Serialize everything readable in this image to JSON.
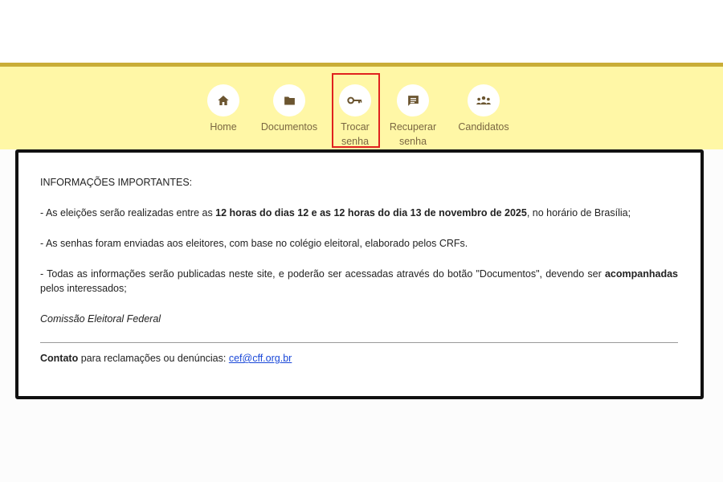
{
  "nav": {
    "items": [
      {
        "label": "Home",
        "icon": "home-icon"
      },
      {
        "label": "Documentos",
        "icon": "folder-icon"
      },
      {
        "label_line1": "Trocar",
        "label_line2": "senha",
        "icon": "key-icon"
      },
      {
        "label_line1": "Recuperar",
        "label_line2": "senha",
        "icon": "message-icon"
      },
      {
        "label": "Candidatos",
        "icon": "people-icon"
      }
    ]
  },
  "colors": {
    "nav_background": "#fff7a6",
    "nav_border": "#c9ad38",
    "icon_color": "#6b5530",
    "highlight": "#e0221f",
    "link": "#1a48d8"
  },
  "content": {
    "heading": "INFORMAÇÕES IMPORTANTES:",
    "p1_prefix": "- As eleições serão realizadas entre as ",
    "p1_bold": "12 horas do dias 12 e as 12 horas do dia 13 de novembro de 2025",
    "p1_suffix": ", no horário de Brasília;",
    "p2": "- As senhas foram enviadas aos eleitores, com base no colégio eleitoral, elaborado pelos CRFs.",
    "p3_prefix": "- Todas as informações serão publicadas neste site, e poderão ser acessadas através do botão \"Documentos\", devendo ser ",
    "p3_bold": "acompanhadas",
    "p3_suffix": " pelos interessados;",
    "signature": "Comissão Eleitoral Federal",
    "contact_bold": "Contato",
    "contact_text": " para reclamações ou denúncias: ",
    "contact_email": "cef@cff.org.br"
  }
}
